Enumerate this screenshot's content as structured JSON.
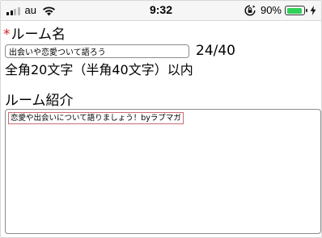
{
  "status_bar": {
    "carrier": "au",
    "time": "9:32",
    "battery_percent_text": "90%",
    "battery_level": 0.9,
    "signal_bars_active": 2,
    "signal_bars_total": 4,
    "colors": {
      "battery": "#2fd158"
    },
    "icons": [
      "signal-icon",
      "wifi-icon",
      "rotation-lock-icon",
      "battery-icon",
      "charging-bolt-icon"
    ]
  },
  "form": {
    "room_name": {
      "required_mark": "*",
      "label": "ルーム名",
      "value": "出会いや恋愛ついて語ろう",
      "counter": "24/40",
      "hint": "全角20文字（半角40文字）以内"
    },
    "room_intro": {
      "label": "ルーム紹介",
      "value": "恋愛や出会いについて語りましょう！byラブマガ"
    },
    "colors": {
      "required": "#d32020"
    }
  }
}
